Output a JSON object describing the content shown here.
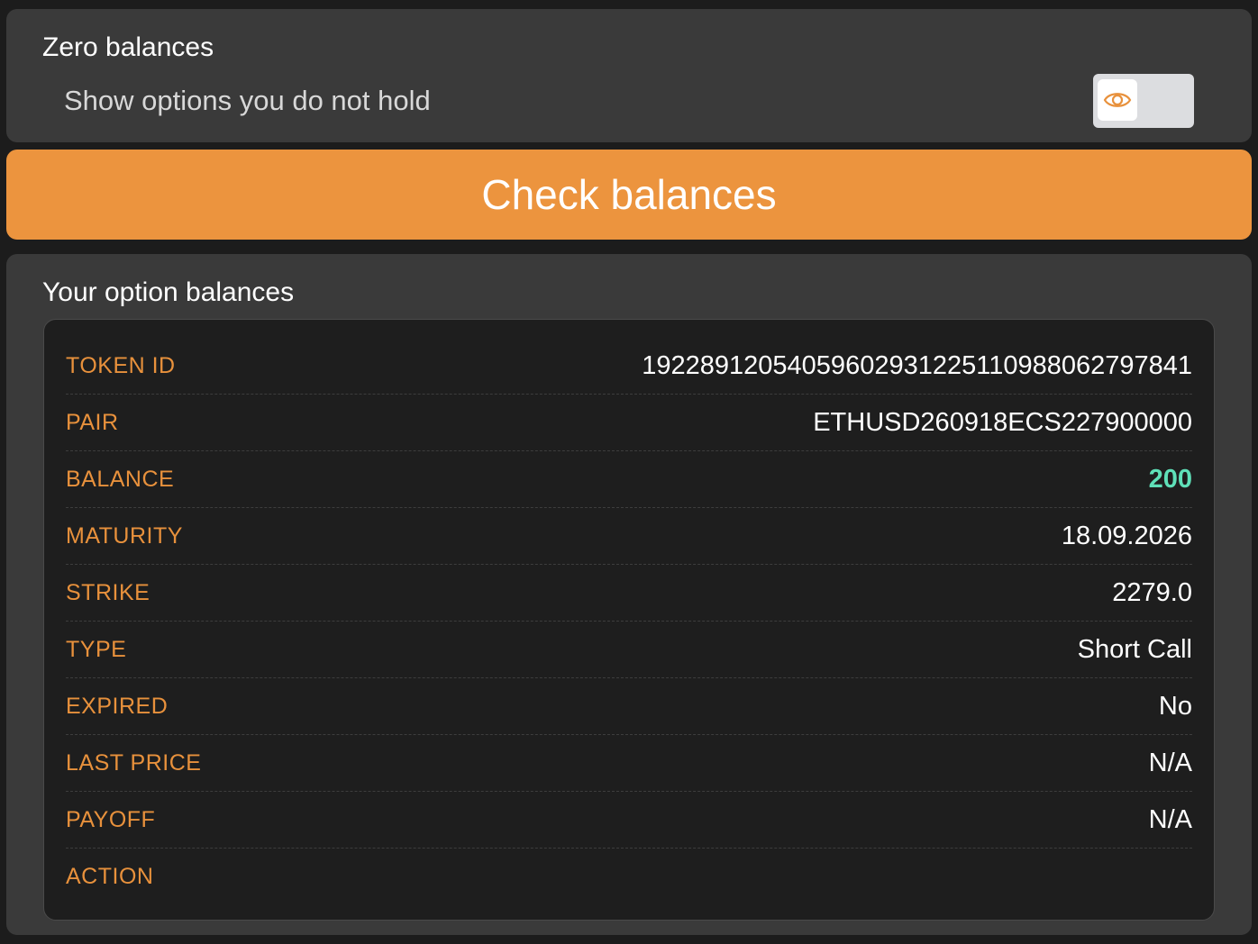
{
  "zero_balances": {
    "title": "Zero balances",
    "description": "Show options you do not hold",
    "toggle_icon": "eye-icon"
  },
  "check_button": {
    "label": "Check balances"
  },
  "balances": {
    "title": "Your option balances",
    "rows": [
      {
        "label": "TOKEN ID",
        "value": "192289120540596029312251109880627978​41"
      },
      {
        "label": "PAIR",
        "value": "ETHUSD260918ECS227900000"
      },
      {
        "label": "BALANCE",
        "value": "200"
      },
      {
        "label": "MATURITY",
        "value": "18.09.2026"
      },
      {
        "label": "STRIKE",
        "value": "2279.0"
      },
      {
        "label": "TYPE",
        "value": "Short Call"
      },
      {
        "label": "EXPIRED",
        "value": "No"
      },
      {
        "label": "LAST PRICE",
        "value": "N/A"
      },
      {
        "label": "PAYOFF",
        "value": "N/A"
      },
      {
        "label": "ACTION",
        "value": ""
      }
    ]
  },
  "colors": {
    "accent": "#ec943e",
    "label": "#e8913c",
    "balance_value": "#5fe0b8",
    "card_bg": "#3a3a3a",
    "table_bg": "#1e1e1e"
  }
}
